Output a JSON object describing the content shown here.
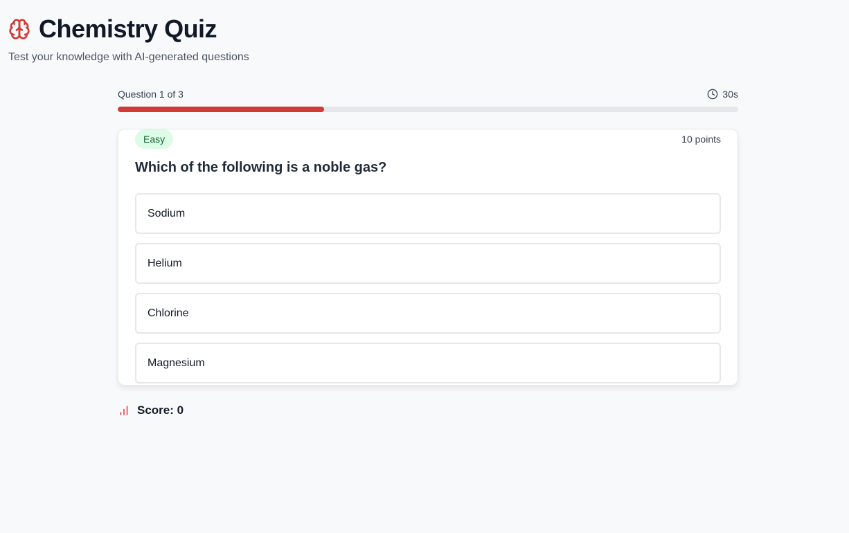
{
  "header": {
    "title": "Chemistry Quiz",
    "subtitle": "Test your knowledge with AI-generated questions",
    "icon": "brain-icon",
    "accent_color": "#d13a35"
  },
  "progress": {
    "label": "Question 1 of 3",
    "timer": "30s",
    "timer_icon": "clock-icon",
    "fraction": 0.333,
    "fill_color": "#d13a35"
  },
  "question": {
    "difficulty": "Easy",
    "points": "10 points",
    "text": "Which of the following is a noble gas?",
    "options": [
      {
        "label": "Sodium"
      },
      {
        "label": "Helium"
      },
      {
        "label": "Chlorine"
      },
      {
        "label": "Magnesium"
      }
    ]
  },
  "score": {
    "label": "Score: 0",
    "icon": "bar-chart-icon"
  }
}
